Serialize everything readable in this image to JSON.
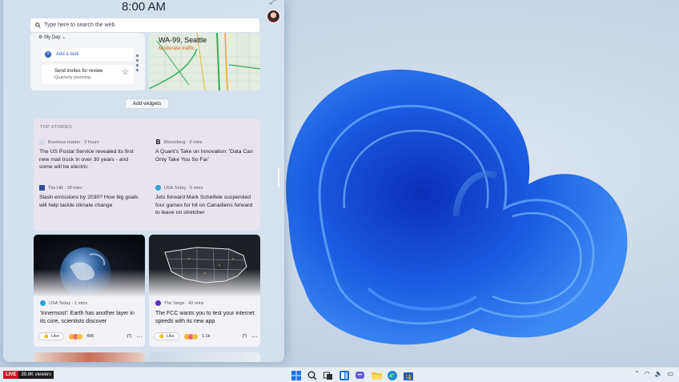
{
  "clock": {
    "time": "8:00 AM"
  },
  "search": {
    "placeholder": "Type here to search the web"
  },
  "todo": {
    "header": "My Day",
    "add_task": "Add a task",
    "task_title": "Send invites for review",
    "task_subtitle": "Quarterly planning"
  },
  "traffic": {
    "location": "WA-99, Seattle",
    "status": "Moderate traffic"
  },
  "add_widgets": {
    "label": "Add widgets"
  },
  "top_stories": {
    "label": "TOP STORIES",
    "items": [
      {
        "source": "Business Insider · 2 hours",
        "headline": "The US Postal Service revealed its first new mail truck in over 30 years - and some will be electric"
      },
      {
        "source": "Bloomberg · 3 mins",
        "headline": "A Quant's Take on Innovation: 'Data Can Only Take You So Far'"
      },
      {
        "source": "The Hill · 18 mins",
        "headline": "Slash emissions by 2030? How big goals will help tackle climate change"
      },
      {
        "source": "USA Today · 5 mins",
        "headline": "Jets forward Mark Scheifele suspended four games for hit on Canadiens forward to leave on stretcher"
      }
    ]
  },
  "feed": [
    {
      "source": "USA Today · 1 mins",
      "headline": "'Innermost': Earth has another layer in its core, scientists discover",
      "like_label": "Like",
      "reactions": "496"
    },
    {
      "source": "The Verge · 42 mins",
      "headline": "The FCC wants you to test your internet speeds with its new app",
      "like_label": "Like",
      "reactions": "1.1k"
    }
  ],
  "taskbar": {
    "live_tag": "LIVE",
    "viewers": "39.8K viewers",
    "icons": [
      "windows-start-icon",
      "search-icon",
      "task-view-icon",
      "widgets-icon",
      "teams-chat-icon",
      "file-explorer-icon",
      "edge-icon",
      "store-icon"
    ]
  },
  "colors": {
    "accent": "#2f62c9",
    "traffic_status": "#d26a1e",
    "live_red": "#d0142c"
  }
}
